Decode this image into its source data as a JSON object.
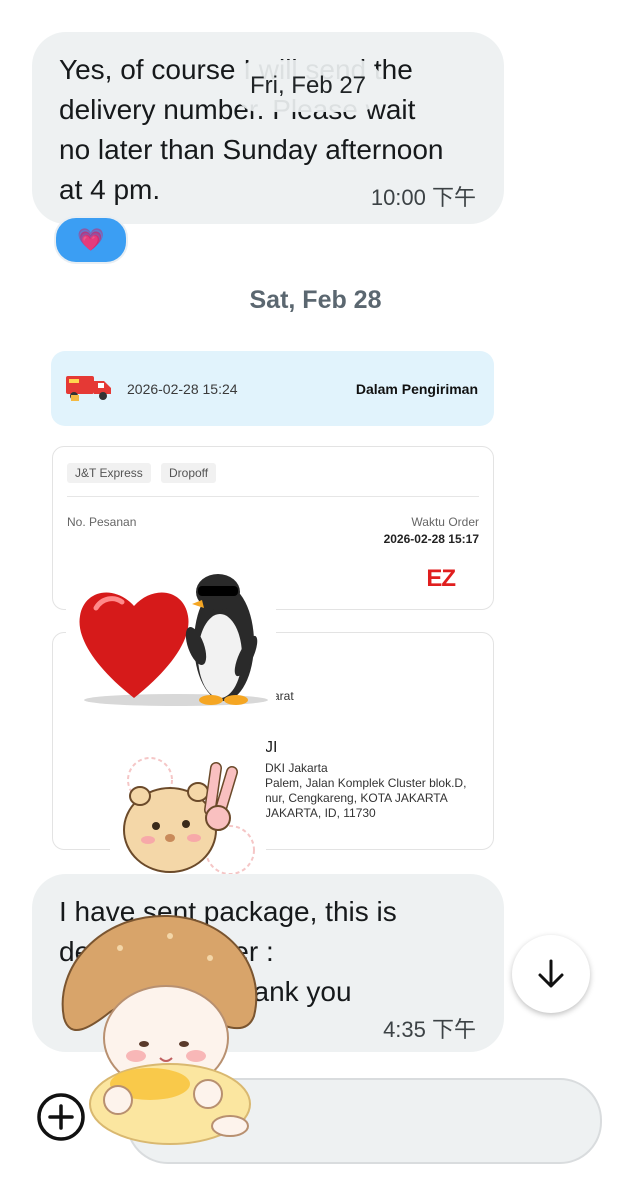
{
  "messages": [
    {
      "text": "Yes, of course I will send the\ndelivery number. Please wait\nno later than Sunday afternoon\nat 4 pm.",
      "time": "10:00 下午",
      "reaction": "💗"
    },
    {
      "text": "I have sent package, this is\ndelivery number :\n                      thank you",
      "time": "4:35 下午"
    }
  ],
  "date_chip": "Fri, Feb 27",
  "date_separator": "Sat, Feb 28",
  "shipment": {
    "datetime": "2026-02-28 15:24",
    "status": "Dalam Pengiriman",
    "tags": [
      "J&T Express",
      "Dropoff"
    ],
    "order_no_label": "No. Pesanan",
    "order_time_label": "Waktu Order",
    "order_time": "2026-02-28 15:17",
    "logo_text": "EZ",
    "region_partial": "arat",
    "name_partial": "JI",
    "address": "DKI Jakarta\nPalem, Jalan Komplek Cluster blok.D,\nnur, Cengkareng, KOTA JAKARTA\nJAKARTA, ID, 11730"
  },
  "icons": {
    "truck": "delivery-truck-icon",
    "scroll": "arrow-down-icon",
    "add": "plus-circle-icon"
  },
  "colors": {
    "bubble": "#eef1f2",
    "shipment_header": "#e1f3fc",
    "reaction": "#3b9ef3",
    "brand_red": "#e01e1e"
  }
}
